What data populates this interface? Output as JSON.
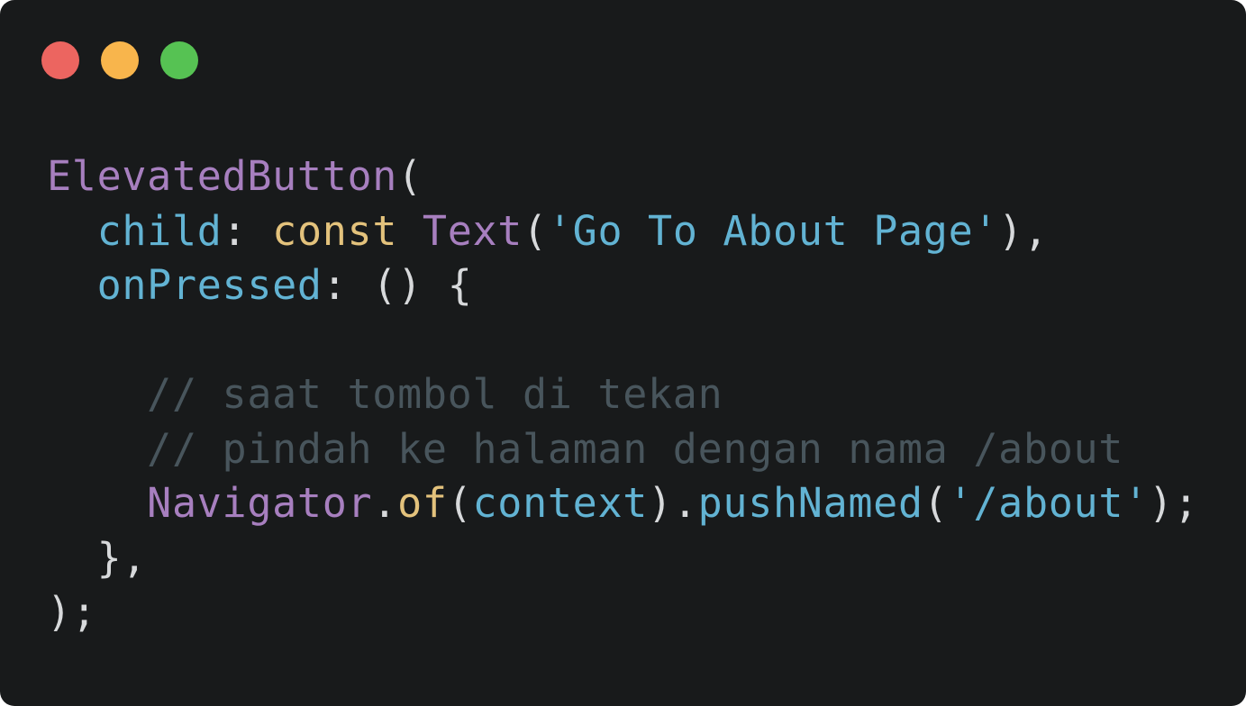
{
  "window": {
    "background": "#181a1b",
    "controls": [
      {
        "name": "close-dot",
        "color": "#ec6560"
      },
      {
        "name": "minimize-dot",
        "color": "#f8b54c"
      },
      {
        "name": "maximize-dot",
        "color": "#56c253"
      }
    ]
  },
  "colors": {
    "class": "#a77fbf",
    "property": "#62b3d3",
    "keyword": "#e3c27c",
    "string": "#62b3d3",
    "comment": "#48555c",
    "punctuation": "#d7d9db"
  },
  "code": {
    "lines": [
      {
        "indent": "",
        "tokens": [
          {
            "text": "ElevatedButton",
            "kind": "class"
          },
          {
            "text": "(",
            "kind": "punctuation"
          }
        ]
      },
      {
        "indent": "  ",
        "tokens": [
          {
            "text": "child",
            "kind": "property"
          },
          {
            "text": ": ",
            "kind": "punctuation"
          },
          {
            "text": "const",
            "kind": "keyword"
          },
          {
            "text": " ",
            "kind": "punctuation"
          },
          {
            "text": "Text",
            "kind": "class"
          },
          {
            "text": "(",
            "kind": "punctuation"
          },
          {
            "text": "'Go To About Page'",
            "kind": "string"
          },
          {
            "text": "),",
            "kind": "punctuation"
          }
        ]
      },
      {
        "indent": "  ",
        "tokens": [
          {
            "text": "onPressed",
            "kind": "property"
          },
          {
            "text": ": () {",
            "kind": "punctuation"
          }
        ]
      },
      {
        "indent": "",
        "tokens": []
      },
      {
        "indent": "    ",
        "tokens": [
          {
            "text": "// saat tombol di tekan",
            "kind": "comment"
          }
        ]
      },
      {
        "indent": "    ",
        "tokens": [
          {
            "text": "// pindah ke halaman dengan nama /about",
            "kind": "comment"
          }
        ]
      },
      {
        "indent": "    ",
        "tokens": [
          {
            "text": "Navigator",
            "kind": "class"
          },
          {
            "text": ".",
            "kind": "punctuation"
          },
          {
            "text": "of",
            "kind": "keyword"
          },
          {
            "text": "(",
            "kind": "punctuation"
          },
          {
            "text": "context",
            "kind": "property"
          },
          {
            "text": ").",
            "kind": "punctuation"
          },
          {
            "text": "pushNamed",
            "kind": "property"
          },
          {
            "text": "(",
            "kind": "punctuation"
          },
          {
            "text": "'/about'",
            "kind": "string"
          },
          {
            "text": ");",
            "kind": "punctuation"
          }
        ]
      },
      {
        "indent": "  ",
        "tokens": [
          {
            "text": "},",
            "kind": "punctuation"
          }
        ]
      },
      {
        "indent": "",
        "tokens": [
          {
            "text": ");",
            "kind": "punctuation"
          }
        ]
      }
    ]
  }
}
